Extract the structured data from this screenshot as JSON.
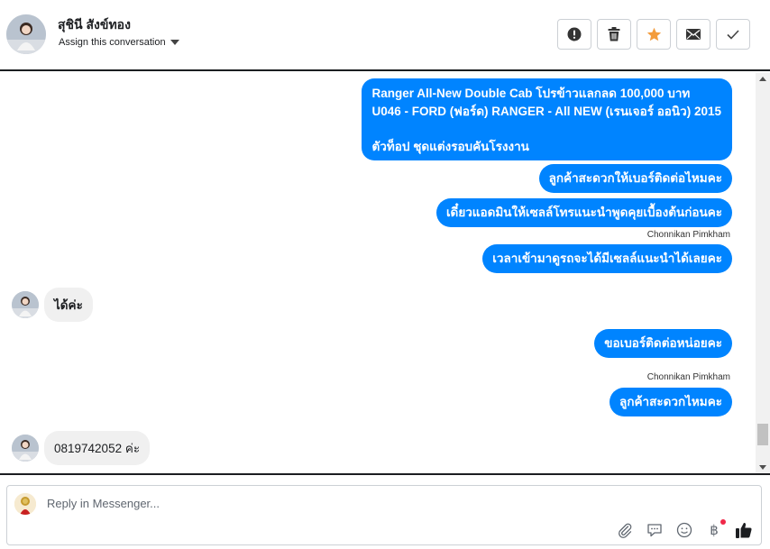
{
  "header": {
    "contact_name": "สุชินี สังข์ทอง",
    "assign_label": "Assign this conversation"
  },
  "actions": {
    "spam": "spam-icon",
    "delete": "trash-icon",
    "star": "star-icon",
    "unread": "envelope-icon",
    "done": "check-icon"
  },
  "colors": {
    "bubble_out": "#0084ff",
    "bubble_in": "#f0f0f0",
    "star": "#f39c3c"
  },
  "thread": {
    "msg1": {
      "line1": "Ranger All-New Double Cab โปรข้าวแลกลด 100,000 บาท",
      "line2": "U046 - FORD (ฟอร์ด) RANGER - All NEW (เรนเจอร์ ออนิว) 2015",
      "line3": "",
      "line4": "ตัวท็อป ชุดแต่งรอบคันโรงงาน"
    },
    "msg2": "ลูกค้าสะดวกให้เบอร์ติดต่อไหมคะ",
    "msg3": "เดี๋ยวแอดมินให้เซลล์โทรแนะนำพูดคุยเบื้องต้นก่อนคะ",
    "sender1": "Chonnikan Pimkham",
    "msg4": "เวลาเข้ามาดูรถจะได้มีเซลล์แนะนำได้เลยคะ",
    "msg5": "ได้ค่ะ",
    "msg6": "ขอเบอร์ติดต่อหน่อยคะ",
    "sender2": "Chonnikan Pimkham",
    "msg7": "ลูกค้าสะดวกไหมคะ",
    "msg8": "0819742052 ค่ะ"
  },
  "composer": {
    "placeholder": "Reply in Messenger...",
    "tools": [
      "paperclip-icon",
      "saved-reply-icon",
      "emoji-icon",
      "baht-icon",
      "thumbs-up-icon"
    ],
    "baht_symbol": "฿"
  }
}
